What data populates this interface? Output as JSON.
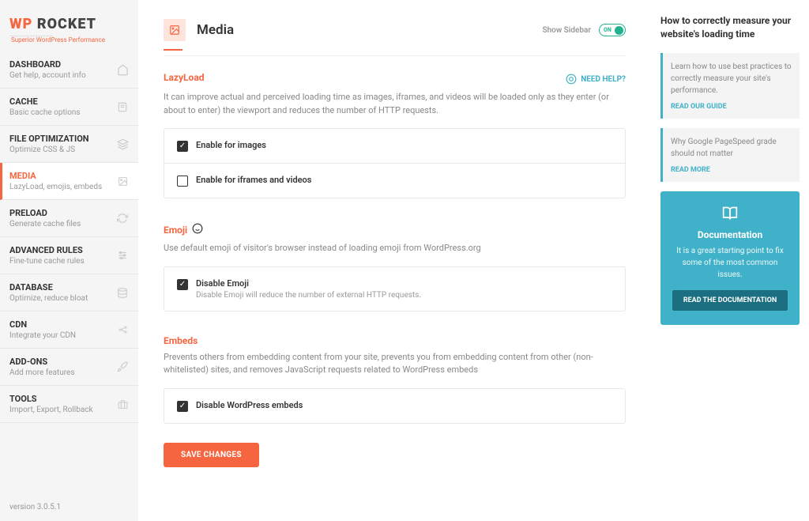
{
  "logo": {
    "part1": "WP",
    "part2": "ROCKET",
    "tagline": "Superior WordPress Performance"
  },
  "nav": [
    {
      "title": "DASHBOARD",
      "desc": "Get help, account info"
    },
    {
      "title": "CACHE",
      "desc": "Basic cache options"
    },
    {
      "title": "FILE OPTIMIZATION",
      "desc": "Optimize CSS & JS"
    },
    {
      "title": "MEDIA",
      "desc": "LazyLoad, emojis, embeds"
    },
    {
      "title": "PRELOAD",
      "desc": "Generate cache files"
    },
    {
      "title": "ADVANCED RULES",
      "desc": "Fine-tune cache rules"
    },
    {
      "title": "DATABASE",
      "desc": "Optimize, reduce bloat"
    },
    {
      "title": "CDN",
      "desc": "Integrate your CDN"
    },
    {
      "title": "ADD-ONS",
      "desc": "Add more features"
    },
    {
      "title": "TOOLS",
      "desc": "Import, Export, Rollback"
    }
  ],
  "version": "version 3.0.5.1",
  "header": {
    "title": "Media",
    "show_sidebar": "Show Sidebar",
    "toggle_on": "ON"
  },
  "lazyload": {
    "title": "LazyLoad",
    "help": "NEED HELP?",
    "desc": "It can improve actual and perceived loading time as images, iframes, and videos will be loaded only as they enter (or about to enter) the viewport and reduces the number of HTTP requests.",
    "opt1": "Enable for images",
    "opt2": "Enable for iframes and videos"
  },
  "emoji": {
    "title": "Emoji",
    "desc": "Use default emoji of visitor's browser instead of loading emoji from WordPress.org",
    "opt_label": "Disable Emoji",
    "opt_desc": "Disable Emoji will reduce the number of external HTTP requests."
  },
  "embeds": {
    "title": "Embeds",
    "desc": "Prevents others from embedding content from your site, prevents you from embedding content from other (non-whitelisted) sites, and removes JavaScript requests related to WordPress embeds",
    "opt_label": "Disable WordPress embeds"
  },
  "save": "SAVE CHANGES",
  "rsidebar": {
    "title": "How to correctly measure your website's loading time",
    "card1": {
      "text": "Learn how to use best practices to correctly measure your site's performance.",
      "link": "READ OUR GUIDE"
    },
    "card2": {
      "text": "Why Google PageSpeed grade should not matter",
      "link": "READ MORE"
    },
    "doc": {
      "title": "Documentation",
      "desc": "It is a great starting point to fix some of the most common issues.",
      "btn": "READ THE DOCUMENTATION"
    }
  }
}
